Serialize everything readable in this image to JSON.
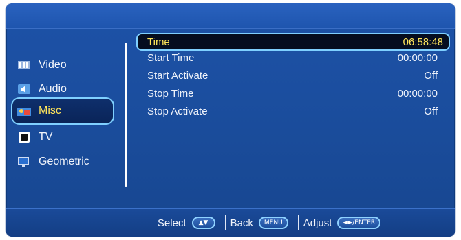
{
  "menu": {
    "items": [
      {
        "label": "Video",
        "icon": "video-icon",
        "selected": false
      },
      {
        "label": "Audio",
        "icon": "audio-icon",
        "selected": false
      },
      {
        "label": "Misc",
        "icon": "misc-icon",
        "selected": true
      },
      {
        "label": "TV",
        "icon": "tv-icon",
        "selected": false
      },
      {
        "label": "Geometric",
        "icon": "geometric-icon",
        "selected": false
      }
    ]
  },
  "settings": {
    "rows": [
      {
        "label": "Time",
        "value": "06:58:48",
        "selected": true
      },
      {
        "label": "Start Time",
        "value": "00:00:00",
        "selected": false
      },
      {
        "label": "Start Activate",
        "value": "Off",
        "selected": false
      },
      {
        "label": "Stop Time",
        "value": "00:00:00",
        "selected": false
      },
      {
        "label": "Stop Activate",
        "value": "Off",
        "selected": false
      }
    ]
  },
  "footer": {
    "select_label": "Select",
    "select_key": "▲▼",
    "back_label": "Back",
    "back_key": "MENU",
    "adjust_label": "Adjust",
    "adjust_key": "◄►/ENTER"
  },
  "colors": {
    "highlight_text": "#ffe55a",
    "highlight_border": "#7fd0ff",
    "panel_bg": "#1b4e9f"
  }
}
